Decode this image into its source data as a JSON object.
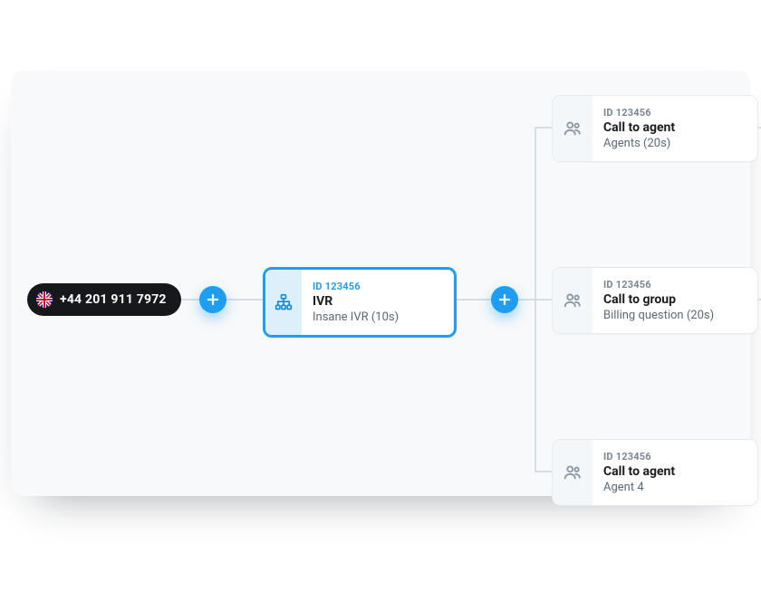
{
  "phone": {
    "number": "+44 201 911 7972",
    "flag": "uk"
  },
  "ivr": {
    "id": "ID 123456",
    "title": "IVR",
    "subtitle": "Insane IVR (10s)"
  },
  "targets": [
    {
      "id": "ID 123456",
      "title": "Call to agent",
      "subtitle": "Agents (20s)"
    },
    {
      "id": "ID 123456",
      "title": "Call to group",
      "subtitle": "Billing question (20s)"
    },
    {
      "id": "ID 123456",
      "title": "Call to agent",
      "subtitle": "Agent 4"
    }
  ]
}
